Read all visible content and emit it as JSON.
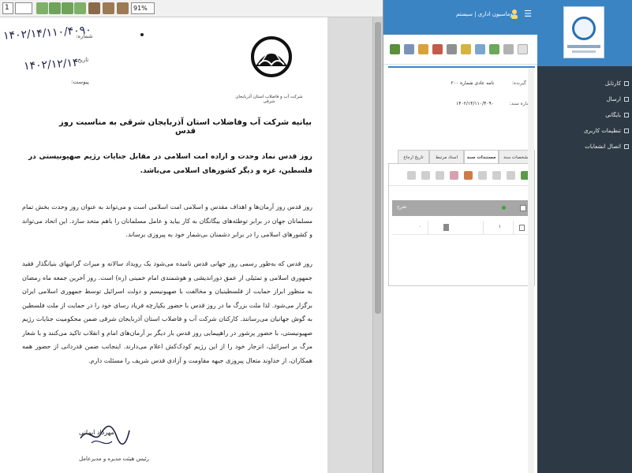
{
  "viewer": {
    "page_input": "1",
    "zoom": "91%",
    "doc": {
      "letter_number": "۱۴۰۲/۱۴/۱۱۰/۴۰۹۰",
      "letter_date": "۱۴۰۲/۱۲/۱۴",
      "label_number": "شماره:",
      "label_date": "تاریخ:",
      "label_attachment": "پیوست:",
      "logo_caption": "شرکت آب و فاضلاب استان آذربایجان شرقی",
      "title": "بیانیه شرکت آب وفاضلاب استان آذربایجان شرقی به مناسبت روز قدس",
      "lead": "روز قدس نماد وحدت و اراده امت اسلامی در مقابل جنایات رژیم صهیونیستی در فلسطین، غزه و دیگر کشورهای اسلامی می‌باشد.",
      "para1": "روز قدس روز آرمان‌ها و اهداف مقدس و اسلامی امت اسلامی است و می‌تواند به عنوان روز وحدت بخش تمام مسلمانان جهان در برابر توطئه‌های بیگانگان به کار بیاید و عامل مسلمانان را باهم متحد سازد. این اتحاد می‌تواند و کشورهای اسلامی را در برابر دشمنان بی‌شمار خود به پیروزی برساند.",
      "para2": "روز قدس که به‌طور رسمی روز جهانی قدس نامیده می‌شود یک رویداد سالانه و میراث گرانبهای بنیانگذار فقید جمهوری اسلامی و تمثیلی از عمق دوراندیشی و هوشمندی امام خمینی (ره) است. روز آخرین جمعه ماه رمضان به منظور ابراز حمایت از فلسطینیان و مخالفت با صهیونیسم و دولت اسرائیل توسط جمهوری اسلامی ایران برگزار می‌شود. لذا ملت بزرگ ما در روز قدس با حضور یکپارچه فریاد رسای خود را در حمایت از ملت فلسطین به گوش جهانیان می‌رسانند. کارکنان شرکت آب و فاضلاب استان آذربایجان شرقی ضمن محکومیت جنایات رژیم صهیونیستی، با حضور پرشور در راهپیمایی روز قدس بار دیگر بر آرمان‌های امام و انقلاب تاکید می‌کنند و با شعار مرگ بر اسرائیل، انزجار خود را از این رژیم کودک‌کش اعلام می‌دارند. اینجانب ضمن قدردانی از حضور همه همکاران، از خداوند متعال پیروزی جبهه مقاومت و آزادی قدس شریف را مسئلت دارم.",
      "signer": "مهرداد ایمانی",
      "signer_role": "رئیس هیئت مدیره و مدیرعامل"
    }
  },
  "app": {
    "header_title": "اتوماسیون اداری | سیستم",
    "fields": [
      {
        "label": "نام گیرنده:",
        "value": "نامه عادی شماره ۲۰۰"
      },
      {
        "label": "شماره سند:",
        "value": "۱۴۰۲/۱۴/۱۱۰/۴۰۹۰"
      }
    ],
    "tabs": [
      "مشخصات سند",
      "مستندات سند",
      "اسناد مرتبط",
      "تاریخ ارجاع"
    ],
    "active_tab": "مستندات سند",
    "grid": {
      "header": "شرح",
      "row_value": "۱"
    }
  },
  "sidebar": {
    "items": [
      {
        "label": "کارتابل"
      },
      {
        "label": "ارسال"
      },
      {
        "label": "بایگانی"
      },
      {
        "label": "تنظیمات کاربری"
      },
      {
        "label": "اتصال انشعابات"
      }
    ]
  },
  "colors": {
    "header_blue": "#3b84c4",
    "sidebar_dark": "#2d3a45",
    "grid_header": "#a7a7a7"
  }
}
